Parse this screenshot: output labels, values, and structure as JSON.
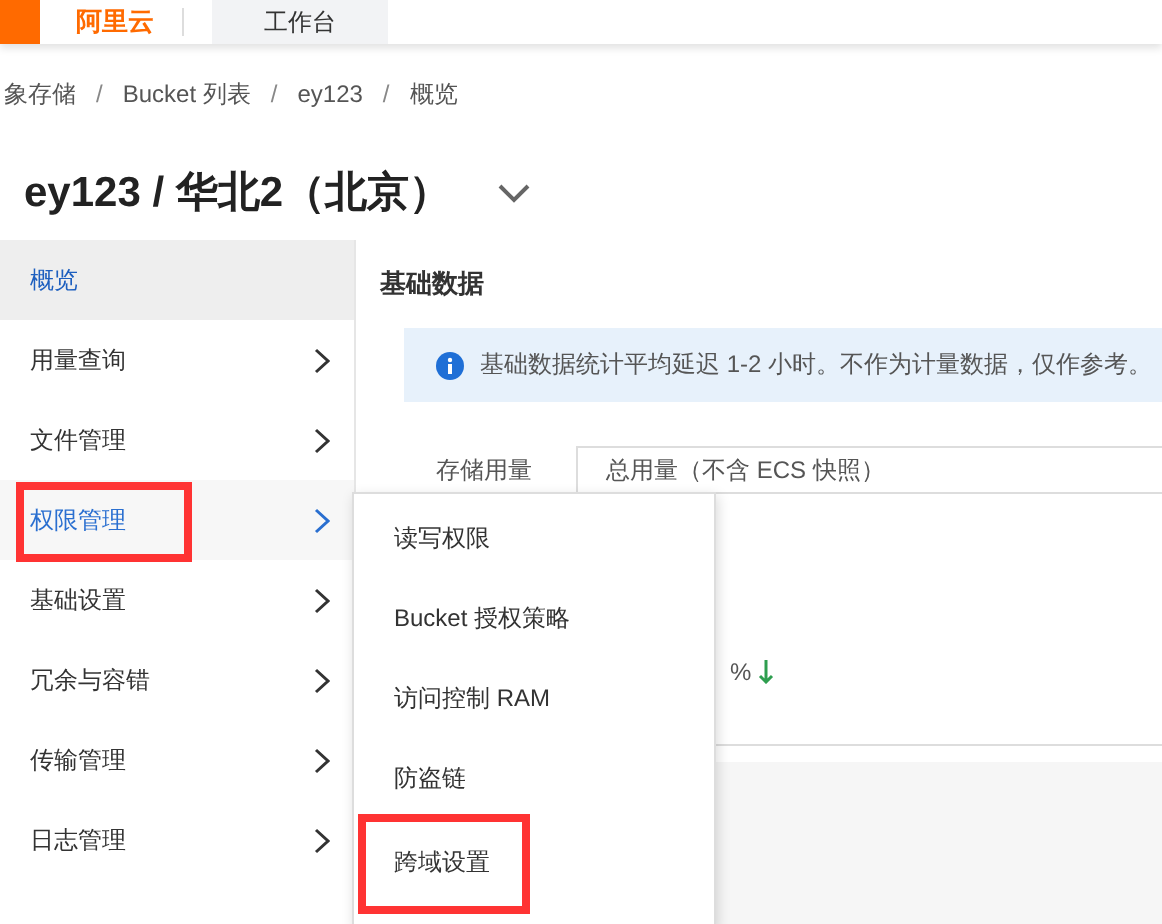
{
  "header": {
    "logo_text": "阿里云",
    "workbench": "工作台"
  },
  "breadcrumb": {
    "separator": "/",
    "items": [
      "象存储",
      "Bucket 列表",
      "ey123",
      "概览"
    ]
  },
  "title": "ey123 / 华北2（北京）",
  "sidebar": {
    "items": [
      {
        "label": "概览",
        "selected": true,
        "hovered": false,
        "highlighted": false,
        "has_children": false
      },
      {
        "label": "用量查询",
        "selected": false,
        "hovered": false,
        "highlighted": false,
        "has_children": true
      },
      {
        "label": "文件管理",
        "selected": false,
        "hovered": false,
        "highlighted": false,
        "has_children": true
      },
      {
        "label": "权限管理",
        "selected": false,
        "hovered": true,
        "highlighted": true,
        "has_children": true
      },
      {
        "label": "基础设置",
        "selected": false,
        "hovered": false,
        "highlighted": false,
        "has_children": true
      },
      {
        "label": "冗余与容错",
        "selected": false,
        "hovered": false,
        "highlighted": false,
        "has_children": true
      },
      {
        "label": "传输管理",
        "selected": false,
        "hovered": false,
        "highlighted": false,
        "has_children": true
      },
      {
        "label": "日志管理",
        "selected": false,
        "hovered": false,
        "highlighted": false,
        "has_children": true
      }
    ]
  },
  "submenu": {
    "items": [
      {
        "label": "读写权限",
        "highlighted": false
      },
      {
        "label": "Bucket 授权策略",
        "highlighted": false
      },
      {
        "label": "访问控制 RAM",
        "highlighted": false
      },
      {
        "label": "防盗链",
        "highlighted": false
      },
      {
        "label": "跨域设置",
        "highlighted": true
      }
    ]
  },
  "main": {
    "heading": "基础数据",
    "notice": "基础数据统计平均延迟 1-2 小时。不作为计量数据，仅作参考。",
    "storage_label": "存储用量",
    "storage_select": "总用量（不含 ECS 快照）",
    "change": "%"
  }
}
